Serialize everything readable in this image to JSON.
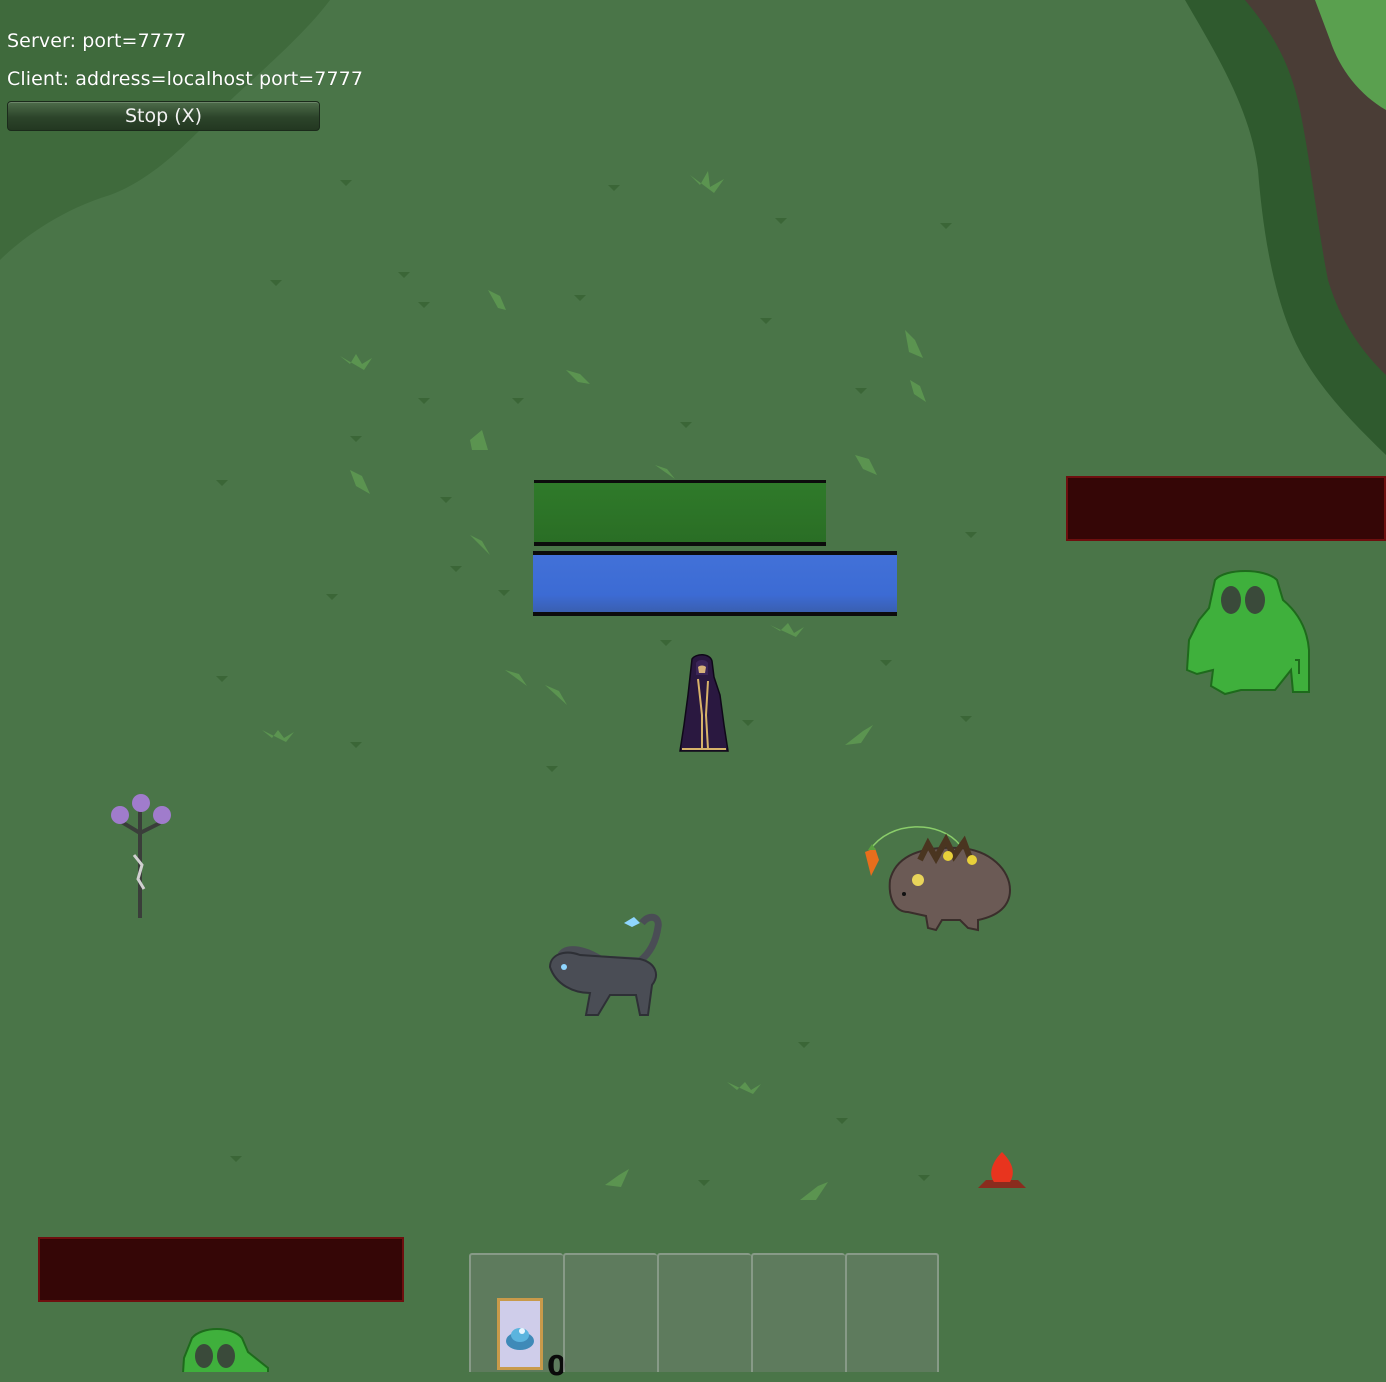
{
  "network": {
    "server_label": "Server: port=7777",
    "client_label": "Client: address=localhost port=7777",
    "stop_button_label": "Stop (X)"
  },
  "player": {
    "health_fraction": 1.0,
    "mana_fraction": 1.0,
    "health_color": "#2f7a2a",
    "mana_color": "#3c6bd4"
  },
  "enemies": [
    {
      "name": "green-golem",
      "health_fraction": 0.0,
      "bar_color": "#350606"
    },
    {
      "name": "green-golem",
      "health_fraction": 0.0,
      "bar_color": "#350606"
    }
  ],
  "hotbar": {
    "slot_count": 5,
    "slots": [
      {
        "item": "spell-card",
        "count": "0"
      },
      {
        "item": "",
        "count": ""
      },
      {
        "item": "",
        "count": ""
      },
      {
        "item": "",
        "count": ""
      },
      {
        "item": "",
        "count": ""
      }
    ]
  },
  "colors": {
    "grass": "#4a7548",
    "dark_grass": "#3d6437",
    "enemy_bar": "#350606"
  }
}
